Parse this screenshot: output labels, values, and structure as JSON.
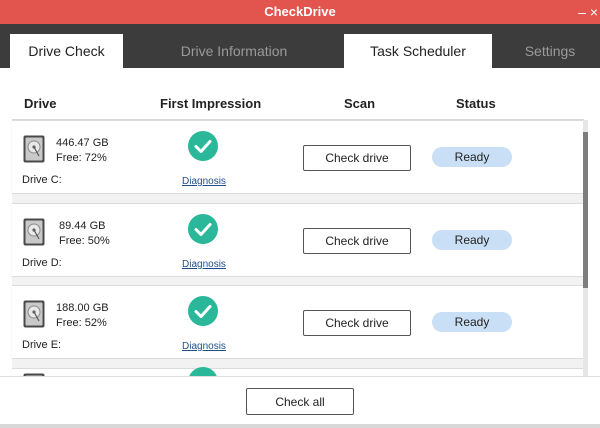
{
  "window": {
    "title": "CheckDrive",
    "minimize_icon": "minimize-icon",
    "close_icon": "close-icon",
    "accent": "#e2544e"
  },
  "tabs": [
    {
      "label": "Drive Check",
      "active": true
    },
    {
      "label": "Drive Information",
      "active": false
    },
    {
      "label": "Task Scheduler",
      "active": false
    },
    {
      "label": "Settings",
      "active": false
    }
  ],
  "columns": {
    "drive": "Drive",
    "first_impression": "First Impression",
    "scan": "Scan",
    "status": "Status"
  },
  "drives": [
    {
      "size": "446.47 GB",
      "free": "Free: 72%",
      "name": "Drive C:",
      "diagnosis": "Diagnosis",
      "button": "Check drive",
      "status": "Ready"
    },
    {
      "size": "89.44 GB",
      "free": "Free: 50%",
      "name": "Drive D:",
      "diagnosis": "Diagnosis",
      "button": "Check drive",
      "status": "Ready"
    },
    {
      "size": "188.00 GB",
      "free": "Free: 52%",
      "name": "Drive E:",
      "diagnosis": "Diagnosis",
      "button": "Check drive",
      "status": "Ready"
    }
  ],
  "footer": {
    "check_all": "Check all"
  },
  "colors": {
    "check": "#2bb89a",
    "status_bg": "#c8dff5",
    "link": "#1f4f8a"
  }
}
